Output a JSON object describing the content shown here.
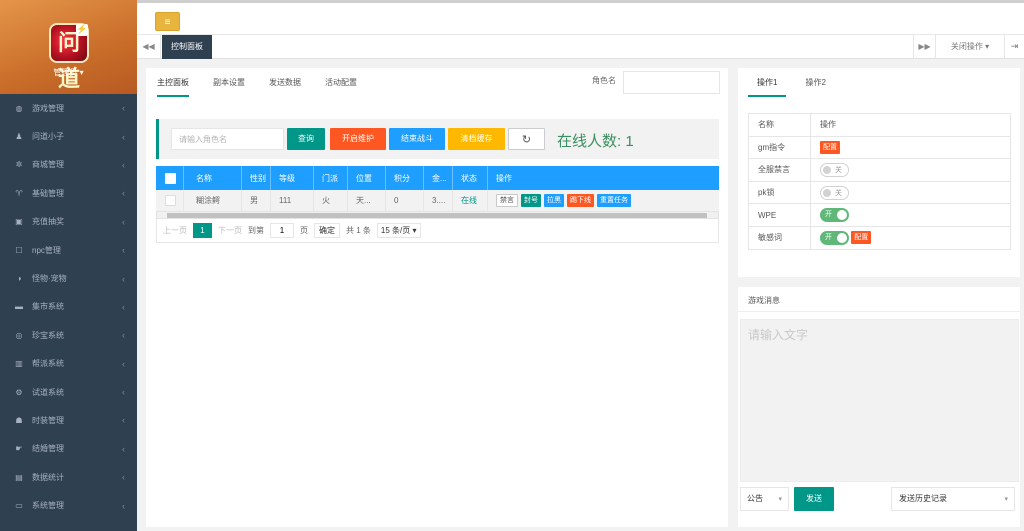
{
  "sidebar": {
    "user_label": "管理员 ▾",
    "logo_text": "问道",
    "items": [
      {
        "label": "游戏管理",
        "icon": "gamepad-icon",
        "glyph": "◍"
      },
      {
        "label": "问道小子",
        "icon": "user-icon",
        "glyph": "♟"
      },
      {
        "label": "商城管理",
        "icon": "asterisk-icon",
        "glyph": "✲"
      },
      {
        "label": "基础管理",
        "icon": "cutlery-icon",
        "glyph": "♈"
      },
      {
        "label": "充值抽奖",
        "icon": "money-icon",
        "glyph": "▣"
      },
      {
        "label": "npc管理",
        "icon": "square-icon",
        "glyph": "☐"
      },
      {
        "label": "怪物·宠物",
        "icon": "adjust-icon",
        "glyph": "◑"
      },
      {
        "label": "集市系统",
        "icon": "bed-icon",
        "glyph": "▬"
      },
      {
        "label": "珍宝系统",
        "icon": "bullseye-icon",
        "glyph": "◎"
      },
      {
        "label": "帮派系统",
        "icon": "columns-icon",
        "glyph": "▥"
      },
      {
        "label": "试道系统",
        "icon": "cogs-icon",
        "glyph": "⚙"
      },
      {
        "label": "时装管理",
        "icon": "cubes-icon",
        "glyph": "☗"
      },
      {
        "label": "结婚管理",
        "icon": "hand-icon",
        "glyph": "☛"
      },
      {
        "label": "数据统计",
        "icon": "database-icon",
        "glyph": "▤"
      },
      {
        "label": "系统管理",
        "icon": "desktop-icon",
        "glyph": "▭"
      }
    ],
    "chevron": "‹"
  },
  "topbar": {
    "toggle_glyph": "≡"
  },
  "tabbar": {
    "prev_glyph": "◀◀",
    "active_tab": "控制面板",
    "next_glyph": "▶▶",
    "close_ops": "关闭操作 ▾",
    "logout_glyph": "⇥"
  },
  "main": {
    "tabs": [
      "主控面板",
      "副本设置",
      "发送数据",
      "活动配置"
    ],
    "role_label": "角色名",
    "search_placeholder": "请输入角色名",
    "btn_query": "查询",
    "btn_maintenance": "开启维护",
    "btn_end_battle": "结束战斗",
    "btn_clear_cache": "清档缓存",
    "btn_refresh": "↻",
    "online_label": "在线人数: 1",
    "grid": {
      "headers": [
        "名称",
        "性别",
        "等级",
        "门派",
        "位置",
        "积分",
        "金...",
        "状态",
        "操作"
      ],
      "row": {
        "name": "糊涂鳄",
        "gender": "男",
        "level": "111",
        "school": "火",
        "location": "天...",
        "points": "0",
        "gold": "3....",
        "status": "在线",
        "ops": [
          "禁言",
          "封号",
          "拉黑",
          "踢下线",
          "重置任务"
        ]
      }
    },
    "pager": {
      "prev": "上一页",
      "current": "1",
      "next": "下一页",
      "goto": "到第",
      "goto_value": "1",
      "page_unit": "页",
      "confirm": "确定",
      "total": "共 1 条",
      "page_size": "15 条/页 ▾"
    }
  },
  "ops_panel": {
    "tabs": [
      "操作1",
      "操作2"
    ],
    "header": {
      "name": "名称",
      "action": "操作"
    },
    "rows": {
      "gm": {
        "label": "gm指令",
        "btn": "配置"
      },
      "mute_all": {
        "label": "全服禁言",
        "state": "关"
      },
      "pk_lock": {
        "label": "pk锁",
        "state": "关"
      },
      "wpe": {
        "label": "WPE",
        "state": "开"
      },
      "sensitive": {
        "label": "敏感词",
        "state": "开",
        "btn": "配置"
      }
    }
  },
  "messages": {
    "title": "游戏消息",
    "placeholder": "请输入文字",
    "type_value": "公告",
    "arrow": "▾",
    "send": "发送",
    "history": "发送历史记录"
  }
}
